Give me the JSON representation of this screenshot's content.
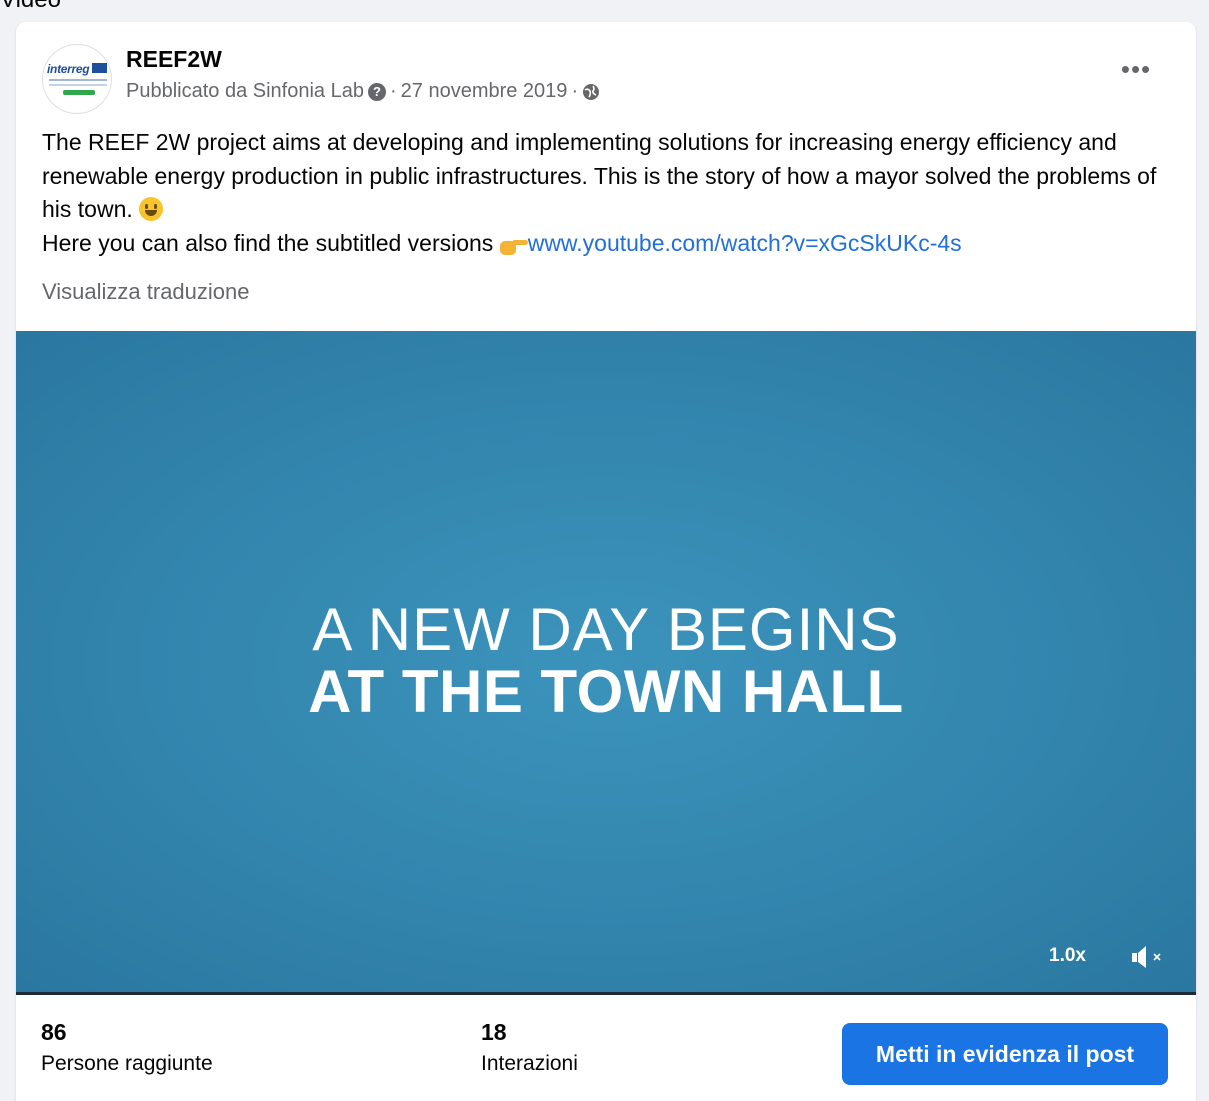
{
  "top_label": "Video",
  "post": {
    "page_name": "REEF2W",
    "published_by": "Pubblicato da Sinfonia Lab",
    "separator": "·",
    "date": "27 novembre 2019",
    "text_line1": "The REEF 2W project aims at developing and implementing solutions for increasing energy efficiency and renewable energy production in public infrastructures. This is the story of how a mayor solved the problems of his town.",
    "text_line2": "Here you can also find the subtitled versions",
    "link": "www.youtube.com/watch?v=xGcSkUKc-4s",
    "see_translation": "Visualizza traduzione"
  },
  "video": {
    "title_line1": "A NEW DAY BEGINS",
    "title_line2": "AT THE TOWN HALL",
    "speed": "1.0x"
  },
  "stats": {
    "reach_value": "86",
    "reach_label": "Persone raggiunte",
    "interactions_value": "18",
    "interactions_label": "Interazioni"
  },
  "boost_button": "Metti in evidenza il post",
  "colors": {
    "accent": "#1b74e4",
    "link": "#216fdb",
    "video_bg": "#3488b0"
  }
}
